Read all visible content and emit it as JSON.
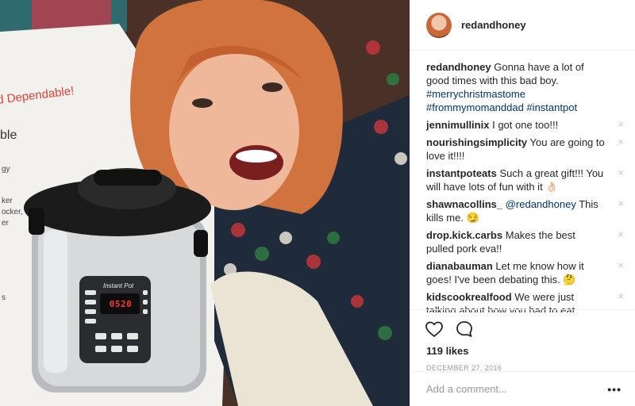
{
  "photo": {
    "box_tagline": "d Dependable!",
    "box_big": "ble",
    "box_small": [
      "gy",
      "ker",
      "ocker,",
      "er",
      "s"
    ],
    "device_brand": "Instant Pot",
    "device_display": "0520"
  },
  "post": {
    "username": "redandhoney",
    "caption": {
      "author": "redandhoney",
      "text": "Gonna have a lot of good times with this bad boy.",
      "hashtags": [
        "#merrychristmastome",
        "#frommymomanddad",
        "#instantpot"
      ]
    },
    "comments": [
      {
        "author": "jennimullinix",
        "text": "I got one too!!!"
      },
      {
        "author": "nourishingsimplicity",
        "text": "You are going to love it!!!!"
      },
      {
        "author": "instantpoteats",
        "text": "Such a great gift!!! You will have lots of fun with it 👌🏻"
      },
      {
        "author": "shawnacollins_",
        "mention": "@redandhoney",
        "text": "This kills me. 😏"
      },
      {
        "author": "drop.kick.carbs",
        "text": "Makes the best pulled pork eva!!"
      },
      {
        "author": "dianabauman",
        "text": "Let me know how it goes! I've been debating this. 🤔"
      },
      {
        "author": "kidscookrealfood",
        "text": "We were just talking about how you had to eat gluten! :( Hope this helps on the other side!!"
      }
    ],
    "remove_glyph": "×",
    "likes": "119 likes",
    "date": "DECEMBER 27, 2016",
    "comment_placeholder": "Add a comment...",
    "more_label": "•••"
  },
  "icons": {
    "like": "heart-icon",
    "comment": "speech-bubble-icon"
  }
}
